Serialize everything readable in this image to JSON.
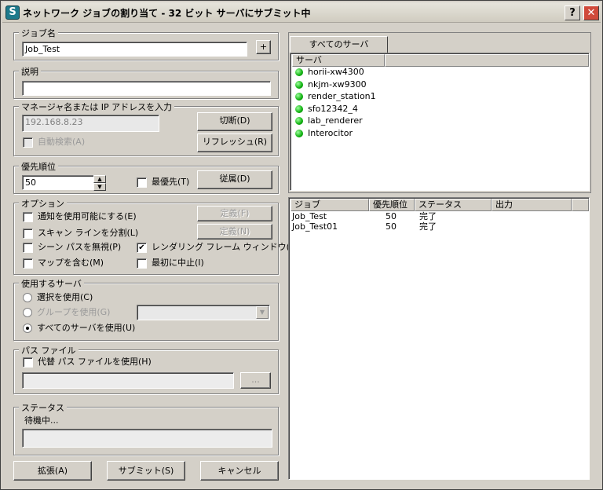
{
  "window": {
    "title": "ネットワーク ジョブの割り当て - 32 ビット サーバにサブミット中",
    "help_label": "?",
    "close_label": "✕",
    "app_icon": "S"
  },
  "job_name": {
    "legend": "ジョブ名",
    "value": "Job_Test",
    "plus_label": "+"
  },
  "description": {
    "legend": "説明",
    "value": ""
  },
  "manager": {
    "legend": "マネージャ名または IP アドレスを入力",
    "value": "192.168.8.23",
    "disconnect_label": "切断(D)",
    "refresh_label": "リフレッシュ(R)",
    "autosearch_label": "自動検索(A)"
  },
  "priority": {
    "legend": "優先順位",
    "value": "50",
    "highest_label": "最優先(T)",
    "depend_label": "従属(D)"
  },
  "options": {
    "legend": "オプション",
    "notify_label": "通知を使用可能にする(E)",
    "split_scan_label": "スキャン ラインを分割(L)",
    "ignore_scene_path_label": "シーン パスを無視(P)",
    "include_maps_label": "マップを含む(M)",
    "render_frame_window_label": "レンダリング フレーム ウィンドウ(R)",
    "render_frame_window_checked": "✔",
    "stop_first_label": "最初に中止(I)",
    "define1_label": "定義(F)",
    "define2_label": "定義(N)"
  },
  "servers_use": {
    "legend": "使用するサーバ",
    "use_selected_label": "選択を使用(C)",
    "use_group_label": "グループを使用(G)",
    "use_all_label": "すべてのサーバを使用(U)"
  },
  "path_file": {
    "legend": "パス ファイル",
    "alt_path_label": "代替 パス ファイルを使用(H)",
    "browse_label": "...",
    "value": ""
  },
  "status": {
    "legend": "ステータス",
    "text": "待機中..."
  },
  "buttons": {
    "expand_label": "拡張(A)",
    "submit_label": "サブミット(S)",
    "cancel_label": "キャンセル"
  },
  "server_panel": {
    "tab_label": "すべてのサーバ",
    "column": "サーバ",
    "servers": [
      "horii-xw4300",
      "nkjm-xw9300",
      "render_station1",
      "sfo12342_4",
      "lab_renderer",
      "Interocitor"
    ],
    "status_color": "#10b010"
  },
  "jobs_panel": {
    "columns": [
      "ジョブ",
      "優先順位",
      "ステータス",
      "出力"
    ],
    "rows": [
      {
        "job": "Job_Test",
        "priority": "50",
        "status": "完了",
        "output": ""
      },
      {
        "job": "Job_Test01",
        "priority": "50",
        "status": "完了",
        "output": ""
      }
    ]
  }
}
